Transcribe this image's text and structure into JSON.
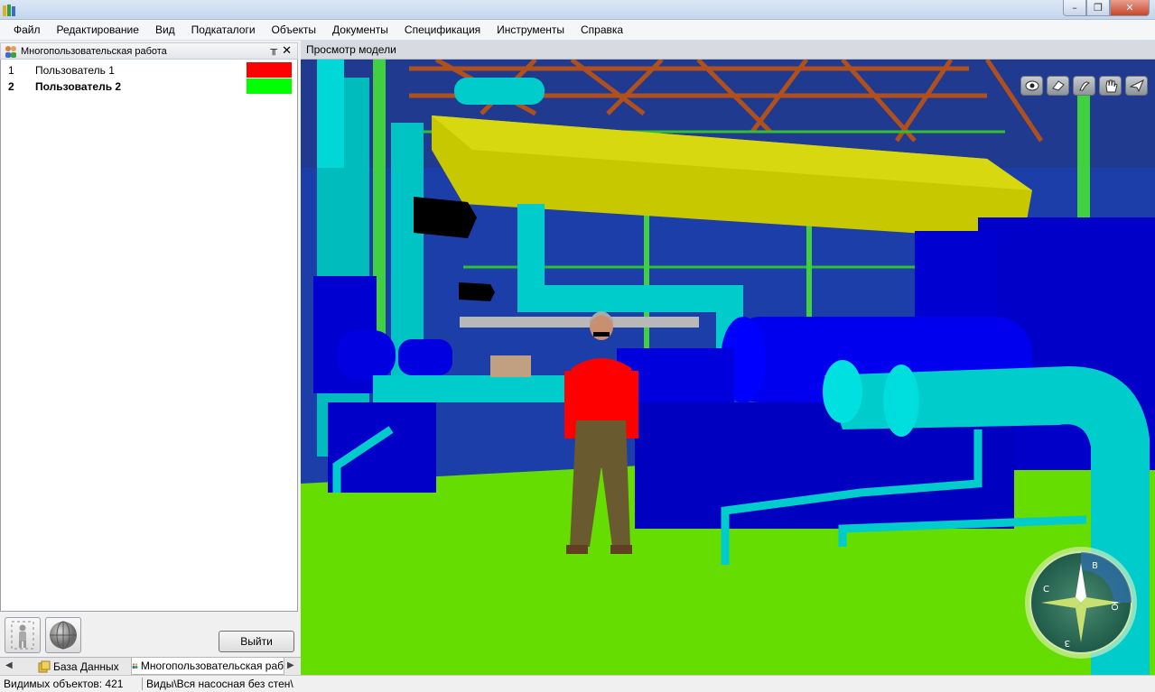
{
  "menu": [
    "Файл",
    "Редактирование",
    "Вид",
    "Подкаталоги",
    "Объекты",
    "Документы",
    "Спецификация",
    "Инструменты",
    "Справка"
  ],
  "window_buttons": {
    "minimize": "–",
    "restore": "❐",
    "close": "✕"
  },
  "panel": {
    "title": "Многопользовательская работа",
    "pin_glyph": "╥",
    "close_glyph": "✕",
    "users": [
      {
        "num": "1",
        "name": "Пользователь 1",
        "color": "#ff0000",
        "bold": false
      },
      {
        "num": "2",
        "name": "Пользователь 2",
        "color": "#00ff00",
        "bold": true
      }
    ],
    "exit_label": "Выйти",
    "tools": [
      "person-tool-icon",
      "globe-tool-icon"
    ]
  },
  "tabs": [
    {
      "label": "База Данных",
      "icon": "database-icon",
      "active": false
    },
    {
      "label": "Многопользовательская раб",
      "icon": "users-icon",
      "active": true
    }
  ],
  "viewport": {
    "title": "Просмотр модели",
    "nav_tools": [
      "eye-icon",
      "fly-icon",
      "walk-icon",
      "hand-icon",
      "plane-icon"
    ],
    "compass_labels": {
      "north": "В",
      "east": "Ю",
      "south": "З",
      "west": "С"
    }
  },
  "status": {
    "objects": "Видимых объектов: 421",
    "view": "Виды\\Вся насосная без стен\\"
  },
  "colors": {
    "user1": "#ff0000",
    "user2": "#00ff00",
    "floor": "#66dd00",
    "pipes": "#00cccc",
    "equipment": "#0000dd"
  }
}
